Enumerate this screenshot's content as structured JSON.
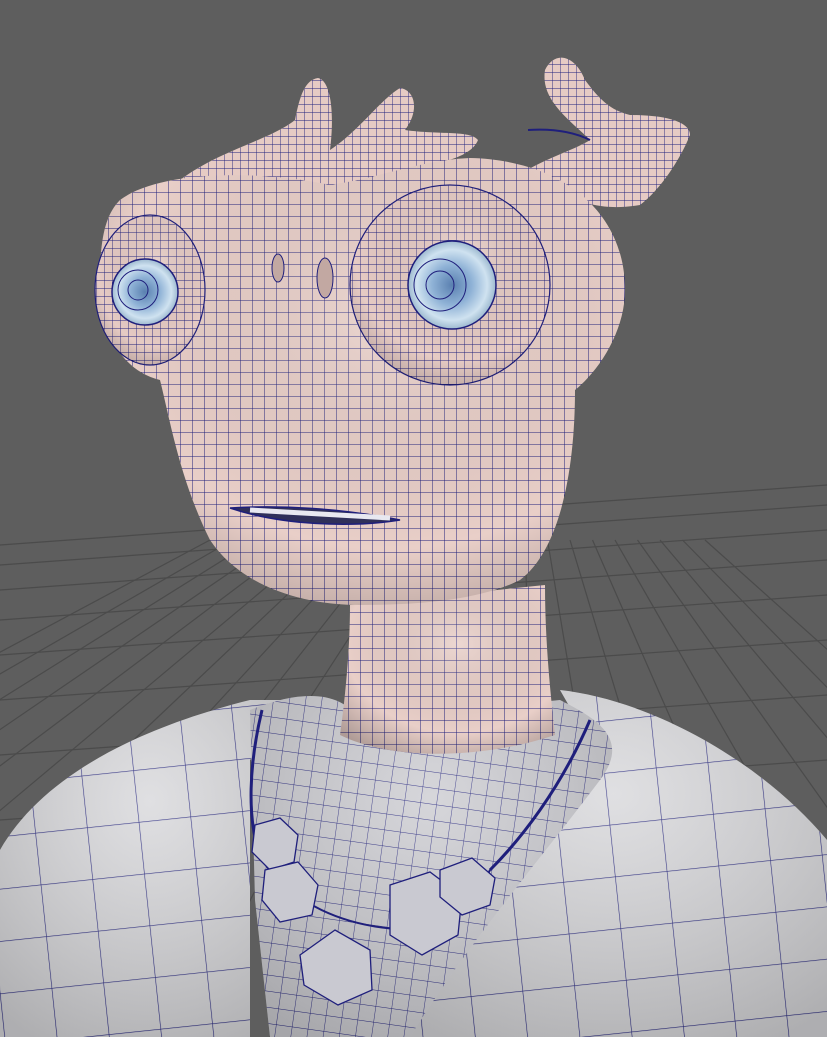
{
  "viewport": {
    "background_color": "#5e5e5e",
    "grid_color": "#4a4a4a",
    "skin_color": "#e8cfc7",
    "cloth_color": "#d9d9dc",
    "wireframe_color": "#1e1e7a",
    "eye_color": "#b9d4e6"
  }
}
